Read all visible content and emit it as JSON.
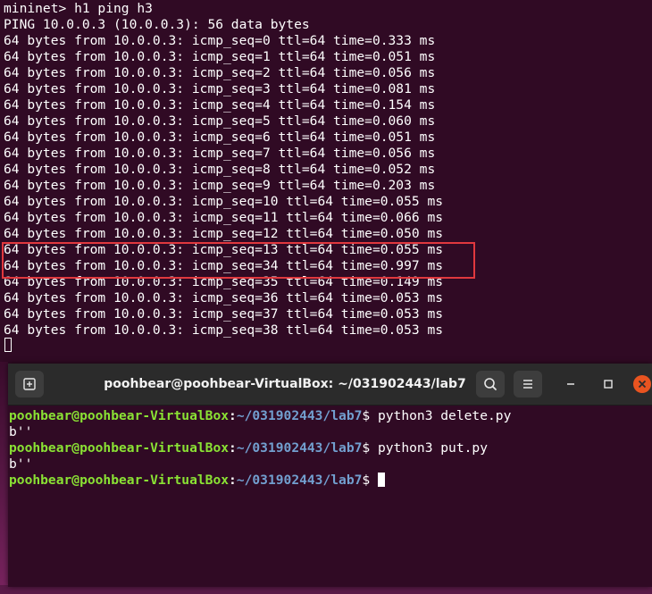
{
  "background_terminal": {
    "lines": [
      "mininet> h1 ping h3",
      "PING 10.0.0.3 (10.0.0.3): 56 data bytes",
      "64 bytes from 10.0.0.3: icmp_seq=0 ttl=64 time=0.333 ms",
      "64 bytes from 10.0.0.3: icmp_seq=1 ttl=64 time=0.051 ms",
      "64 bytes from 10.0.0.3: icmp_seq=2 ttl=64 time=0.056 ms",
      "64 bytes from 10.0.0.3: icmp_seq=3 ttl=64 time=0.081 ms",
      "64 bytes from 10.0.0.3: icmp_seq=4 ttl=64 time=0.154 ms",
      "64 bytes from 10.0.0.3: icmp_seq=5 ttl=64 time=0.060 ms",
      "64 bytes from 10.0.0.3: icmp_seq=6 ttl=64 time=0.051 ms",
      "64 bytes from 10.0.0.3: icmp_seq=7 ttl=64 time=0.056 ms",
      "64 bytes from 10.0.0.3: icmp_seq=8 ttl=64 time=0.052 ms",
      "64 bytes from 10.0.0.3: icmp_seq=9 ttl=64 time=0.203 ms",
      "64 bytes from 10.0.0.3: icmp_seq=10 ttl=64 time=0.055 ms",
      "64 bytes from 10.0.0.3: icmp_seq=11 ttl=64 time=0.066 ms",
      "64 bytes from 10.0.0.3: icmp_seq=12 ttl=64 time=0.050 ms",
      "64 bytes from 10.0.0.3: icmp_seq=13 ttl=64 time=0.055 ms",
      "64 bytes from 10.0.0.3: icmp_seq=34 ttl=64 time=0.997 ms",
      "64 bytes from 10.0.0.3: icmp_seq=35 ttl=64 time=0.149 ms",
      "64 bytes from 10.0.0.3: icmp_seq=36 ttl=64 time=0.053 ms",
      "64 bytes from 10.0.0.3: icmp_seq=37 ttl=64 time=0.053 ms",
      "64 bytes from 10.0.0.3: icmp_seq=38 ttl=64 time=0.053 ms"
    ]
  },
  "foreground_terminal": {
    "title": "poohbear@poohbear-VirtualBox: ~/031902443/lab7",
    "icons": {
      "new_tab": "new-tab-icon",
      "search": "search-icon",
      "menu": "hamburger-menu-icon",
      "minimize": "minimize-icon",
      "maximize": "maximize-icon",
      "close": "close-icon"
    },
    "prompt": {
      "user_host": "poohbear@poohbear-VirtualBox",
      "separator": ":",
      "path": "~/031902443/lab7",
      "symbol": "$ "
    },
    "commands": [
      {
        "command": "python3 delete.py",
        "output": "b''"
      },
      {
        "command": "python3 put.py",
        "output": "b''"
      }
    ]
  },
  "colors": {
    "terminal_bg": "#300a24",
    "titlebar_bg": "#2b2b2b",
    "prompt_user": "#8ae234",
    "prompt_path": "#729fcf",
    "highlight_box": "#e0383e",
    "close_button": "#e95420"
  }
}
